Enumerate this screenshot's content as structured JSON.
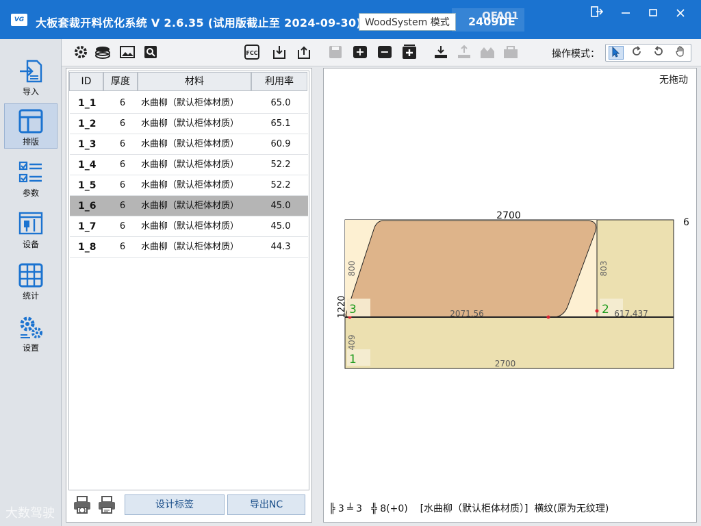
{
  "window": {
    "logo_text": "VG",
    "title": "大板套裁开料优化系统  V 2.6.35  (试用版截止至 2024-09-30)",
    "mode_label": "WoodSystem 模式",
    "code_top": "QFA01",
    "code_bottom": "2409DE",
    "controls": [
      "exit-icon",
      "minimize-icon",
      "maximize-icon",
      "close-icon"
    ]
  },
  "sidebar": {
    "items": [
      {
        "label": "导入",
        "icon": "import-icon"
      },
      {
        "label": "排版",
        "icon": "layout-icon",
        "active": true
      },
      {
        "label": "参数",
        "icon": "checklist-icon"
      },
      {
        "label": "设备",
        "icon": "machine-icon"
      },
      {
        "label": "统计",
        "icon": "table-grid-icon"
      },
      {
        "label": "设置",
        "icon": "gears-icon"
      }
    ]
  },
  "toolbar": {
    "op_mode_label": "操作模式：",
    "icons": [
      "gear-icon",
      "layers-icon",
      "image-icon",
      "search-image-icon",
      "fcc-icon",
      "download-box-icon",
      "upload-box-icon",
      "save-icon",
      "add-icon",
      "remove-icon",
      "add-box-icon",
      "import-down-icon",
      "export-up-icon",
      "machine-gray-icon",
      "machine-gray2-icon"
    ],
    "op_modes": [
      "pointer-icon",
      "rotate-icon",
      "refresh-icon",
      "hand-icon"
    ]
  },
  "table": {
    "headers": [
      "ID",
      "厚度",
      "材料",
      "利用率"
    ],
    "rows": [
      {
        "id": "1_1",
        "thickness": "6",
        "material": "水曲柳（默认柜体材质）",
        "util": "65.0"
      },
      {
        "id": "1_2",
        "thickness": "6",
        "material": "水曲柳（默认柜体材质）",
        "util": "65.1"
      },
      {
        "id": "1_3",
        "thickness": "6",
        "material": "水曲柳（默认柜体材质）",
        "util": "60.9"
      },
      {
        "id": "1_4",
        "thickness": "6",
        "material": "水曲柳（默认柜体材质）",
        "util": "52.2"
      },
      {
        "id": "1_5",
        "thickness": "6",
        "material": "水曲柳（默认柜体材质）",
        "util": "52.2"
      },
      {
        "id": "1_6",
        "thickness": "6",
        "material": "水曲柳（默认柜体材质）",
        "util": "45.0",
        "selected": true
      },
      {
        "id": "1_7",
        "thickness": "6",
        "material": "水曲柳（默认柜体材质）",
        "util": "45.0"
      },
      {
        "id": "1_8",
        "thickness": "6",
        "material": "水曲柳（默认柜体材质）",
        "util": "44.3"
      }
    ]
  },
  "bottom": {
    "design_label_btn": "设计标签",
    "export_nc_btn": "导出NC"
  },
  "canvas": {
    "drag_status": "无拖动",
    "board": {
      "width_label": "2700",
      "height_label": "1220",
      "thickness": "6",
      "part_labels": {
        "p3": "3",
        "p2": "2",
        "p1": "1"
      },
      "dims": {
        "p3_h": "800",
        "p2_h": "803",
        "p1_h": "409",
        "cut_len": "2071.56",
        "p2_w": "617.437",
        "bottom_w": "2700"
      }
    },
    "status": {
      "counts_a": "╠ 3 ╧ 3",
      "counts_b": "╬ 8(+0)",
      "material": "[水曲柳（默认柜体材质）]",
      "grain": "横纹(原为无纹理)"
    }
  },
  "watermark": "大数驾驶"
}
